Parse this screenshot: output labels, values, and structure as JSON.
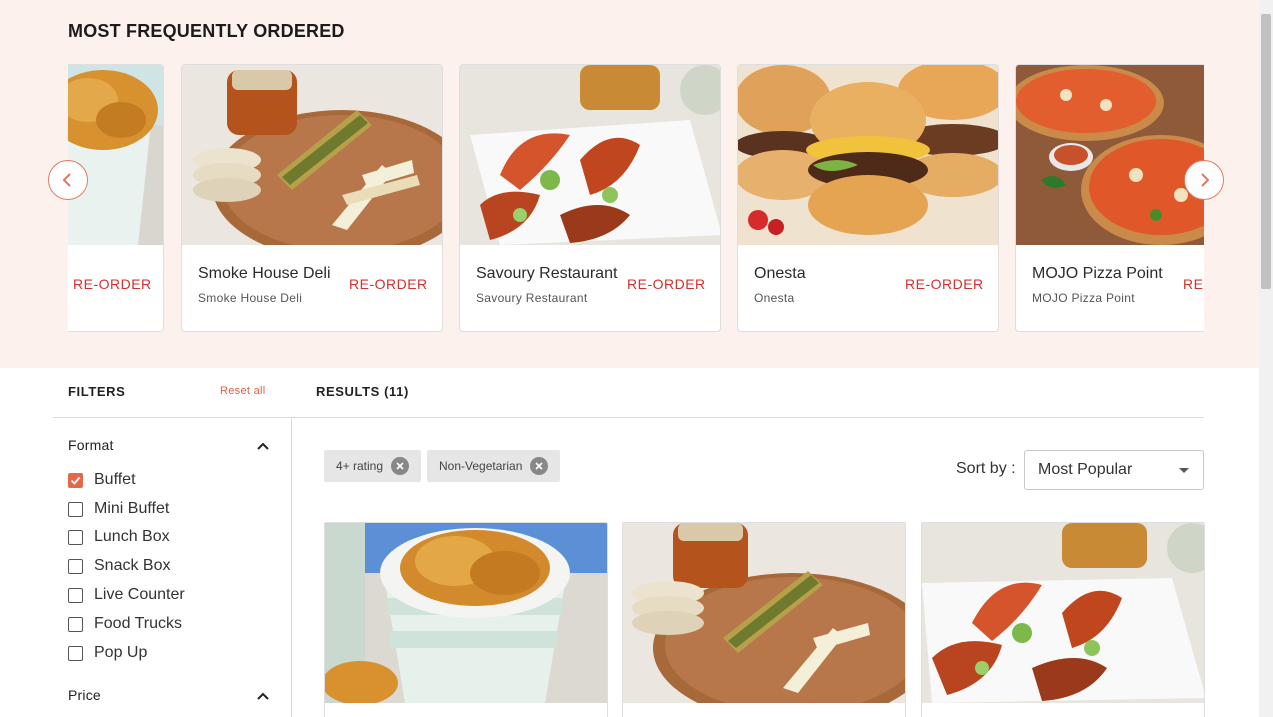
{
  "section": {
    "title": "MOST FREQUENTLY ORDERED"
  },
  "carousel": {
    "cards": [
      {
        "name": "",
        "sub": "",
        "reorder": "RE-ORDER",
        "image": "fried-chicken"
      },
      {
        "name": "Smoke House Deli",
        "sub": "Smoke House Deli",
        "reorder": "RE-ORDER",
        "image": "corn-platter"
      },
      {
        "name": "Savoury Restaurant",
        "sub": "Savoury Restaurant",
        "reorder": "RE-ORDER",
        "image": "shrimp-skewers"
      },
      {
        "name": "Onesta",
        "sub": "Onesta",
        "reorder": "RE-ORDER",
        "image": "burgers"
      },
      {
        "name": "MOJO Pizza Point",
        "sub": "MOJO Pizza Point",
        "reorder": "RE-ORDER",
        "image": "pizza"
      }
    ],
    "prev_icon": "chevron-left-icon",
    "next_icon": "chevron-right-icon"
  },
  "filters": {
    "title": "FILTERS",
    "reset": "Reset all",
    "sections": [
      {
        "title": "Format",
        "options": [
          {
            "label": "Buffet",
            "checked": true
          },
          {
            "label": "Mini Buffet",
            "checked": false
          },
          {
            "label": "Lunch Box",
            "checked": false
          },
          {
            "label": "Snack Box",
            "checked": false
          },
          {
            "label": "Live Counter",
            "checked": false
          },
          {
            "label": "Food Trucks",
            "checked": false
          },
          {
            "label": "Pop Up",
            "checked": false
          }
        ]
      },
      {
        "title": "Price",
        "options": []
      }
    ]
  },
  "results": {
    "title": "RESULTS (11)",
    "chips": [
      {
        "label": "4+ rating"
      },
      {
        "label": "Non-Vegetarian"
      }
    ],
    "sort": {
      "label": "Sort by :",
      "value": "Most Popular"
    },
    "cards": [
      {
        "image": "fried-chicken"
      },
      {
        "image": "corn-platter"
      },
      {
        "image": "shrimp-skewers"
      }
    ]
  },
  "colors": {
    "banner_bg": "#fdf1ee",
    "accent": "#e8674a",
    "reorder": "#d0312d"
  }
}
